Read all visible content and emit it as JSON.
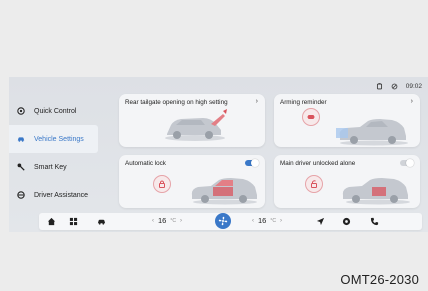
{
  "status": {
    "time": "09:02"
  },
  "sidebar": {
    "items": [
      {
        "label": "Quick Control",
        "icon": "steering-wheel-icon"
      },
      {
        "label": "Vehicle Settings",
        "icon": "car-icon",
        "active": true
      },
      {
        "label": "Smart Key",
        "icon": "key-icon"
      },
      {
        "label": "Driver Assistance",
        "icon": "steering-icon"
      }
    ]
  },
  "cards": {
    "tailgate": {
      "title": "Rear tailgate opening on high setting"
    },
    "arming": {
      "title": "Arming reminder"
    },
    "autolock": {
      "title": "Automatic lock",
      "enabled": true
    },
    "unlock": {
      "title": "Main driver unlocked alone",
      "enabled": false
    }
  },
  "dock": {
    "left_temp": "16",
    "right_temp": "16",
    "temp_unit": "°C"
  },
  "colors": {
    "accent": "#3a78c8",
    "alert": "#d9545d"
  },
  "caption": "OMT26-2030"
}
